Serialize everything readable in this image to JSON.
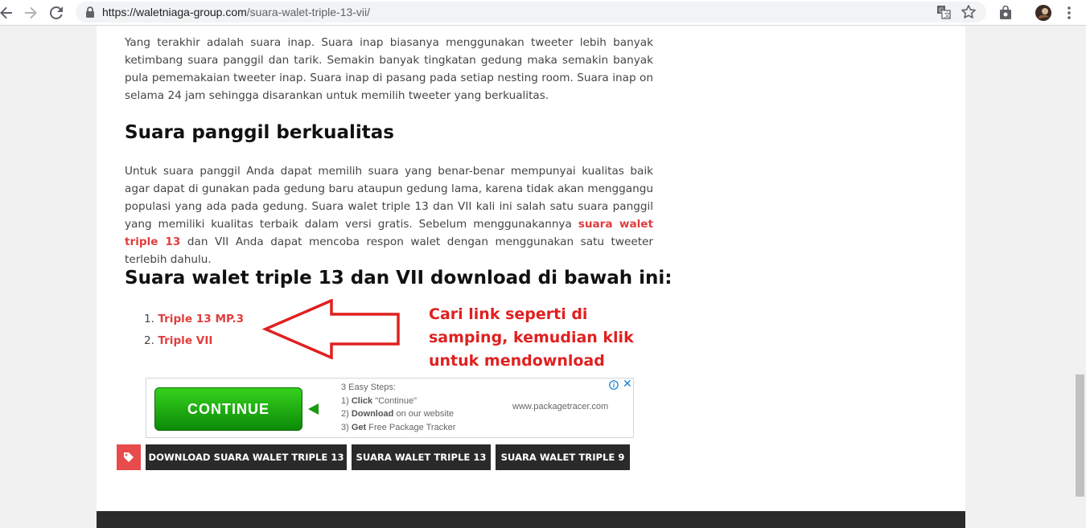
{
  "browser": {
    "url_domain": "https://waletniaga-group.com",
    "url_path": "/suara-walet-triple-13-vii/"
  },
  "article": {
    "para1": "Yang terakhir adalah suara inap. Suara inap biasanya menggunakan tweeter lebih banyak ketimbang suara panggil dan tarik. Semakin banyak tingkatan gedung maka semakin banyak pula pememakaian tweeter inap. Suara inap di pasang pada setiap nesting room. Suara inap on selama 24 jam sehingga disarankan untuk memilih tweeter yang berkualitas.",
    "heading1": "Suara panggil berkualitas",
    "para2_before": "Untuk suara panggil Anda dapat memilih suara yang benar-benar mempunyai kualitas baik agar dapat di gunakan pada gedung baru ataupun gedung lama, karena tidak akan menggangu populasi yang ada pada gedung. Suara walet triple 13 dan VII kali ini salah satu suara panggil yang memiliki kualitas terbaik dalam versi gratis. Sebelum menggunakannya ",
    "para2_link": "suara walet triple 13",
    "para2_after": " dan VII Anda dapat mencoba respon walet dengan menggunakan satu tweeter terlebih dahulu.",
    "heading2": "Suara walet triple 13 dan VII download di bawah ini:",
    "downloads": [
      {
        "num": "1.",
        "label": "Triple 13 MP.3"
      },
      {
        "num": "2.",
        "label": "Triple VII"
      }
    ],
    "annotation": "Cari link seperti di samping, kemudian klik untuk mendownload"
  },
  "ad": {
    "button": "CONTINUE",
    "steps_title": "3 Easy Steps:",
    "step1_num": "1)",
    "step1_bold": "Click",
    "step1_rest": "\"Continue\"",
    "step2_num": "2)",
    "step2_bold": "Download",
    "step2_rest": "on our website",
    "step3_num": "3)",
    "step3_bold": "Get",
    "step3_rest": "Free Package Tracker",
    "url": "www.packagetracer.com"
  },
  "tags": [
    "DOWNLOAD SUARA WALET TRIPLE 13",
    "SUARA WALET TRIPLE 13",
    "SUARA WALET TRIPLE 9"
  ],
  "colors": {
    "link": "#e03e3e",
    "annotation": "#e02020",
    "tag_bg": "#2a2a2a",
    "tag_icon_bg": "#e84b4b",
    "footer": "#2b2b2b"
  }
}
